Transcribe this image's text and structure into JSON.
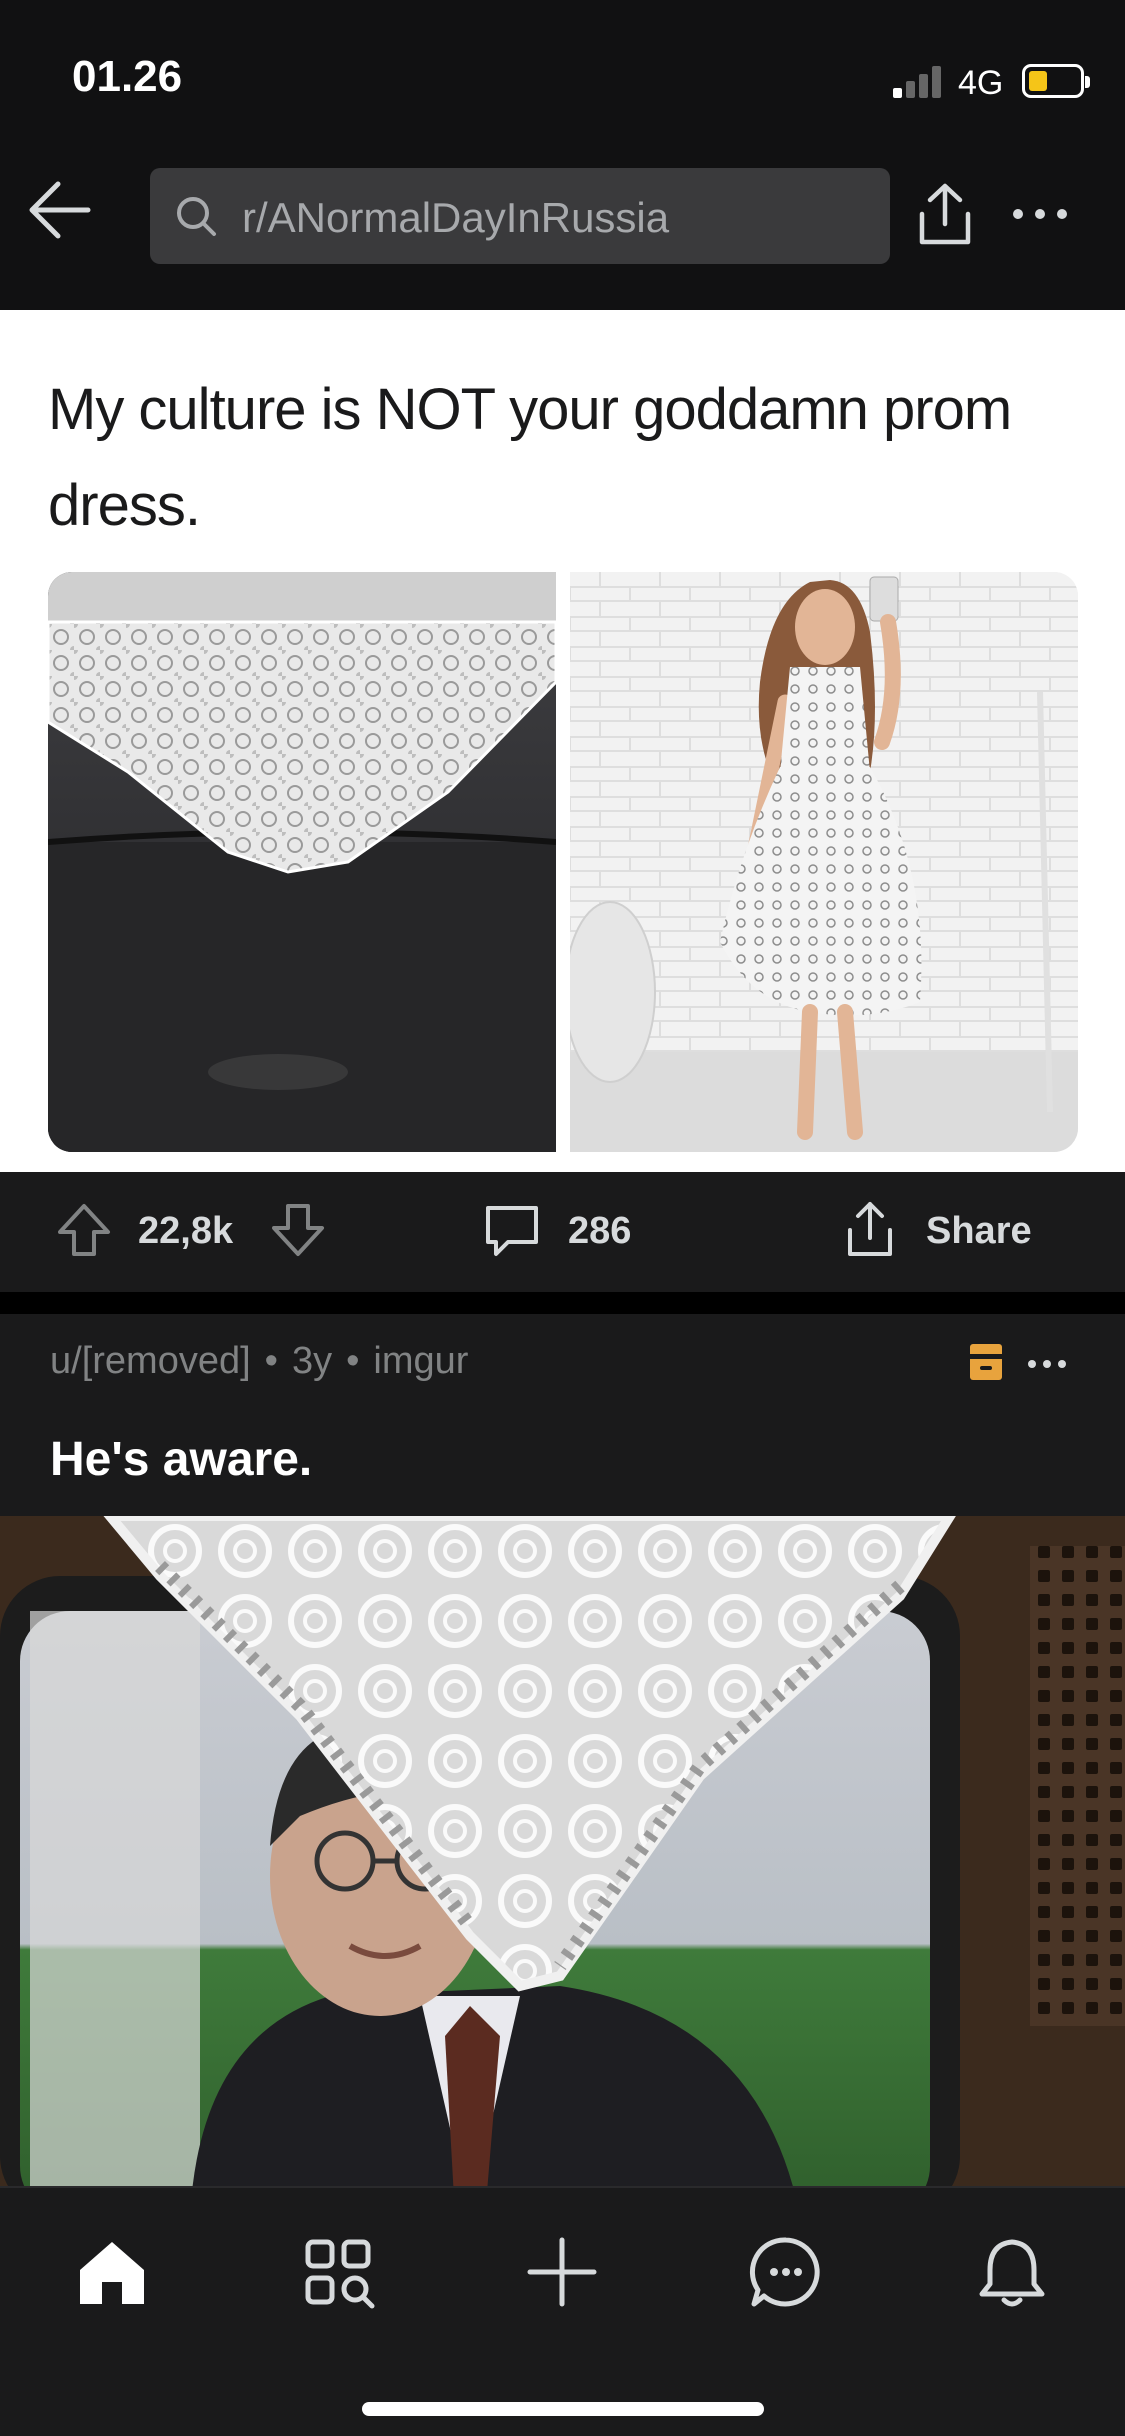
{
  "status_bar": {
    "time": "01.26",
    "network": "4G",
    "battery_color": "#f5c518"
  },
  "header": {
    "search_text": "r/ANormalDayInRussia"
  },
  "post1": {
    "meme_text": "My culture is NOT your goddamn prom dress.",
    "upvotes": "22,8k",
    "comments": "286",
    "share_label": "Share"
  },
  "post2": {
    "author": "u/[removed]",
    "age": "3y",
    "domain": "imgur",
    "title": "He's aware.",
    "mod_icon_color": "#e8a33d"
  },
  "bottom_nav": {
    "items": [
      "home-icon",
      "discover-icon",
      "create-icon",
      "chat-icon",
      "notifications-icon"
    ]
  },
  "colors": {
    "background": "#111112",
    "card": "#1a1a1b",
    "text": "#d7dadc",
    "muted": "#818384"
  }
}
